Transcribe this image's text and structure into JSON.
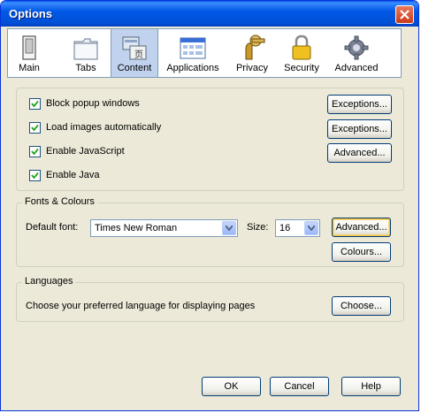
{
  "window": {
    "title": "Options"
  },
  "toolbar": {
    "items": [
      {
        "label": "Main",
        "icon": "main-icon"
      },
      {
        "label": "Tabs",
        "icon": "tabs-icon"
      },
      {
        "label": "Content",
        "icon": "content-icon",
        "selected": true
      },
      {
        "label": "Applications",
        "icon": "applications-icon"
      },
      {
        "label": "Privacy",
        "icon": "privacy-icon"
      },
      {
        "label": "Security",
        "icon": "security-icon"
      },
      {
        "label": "Advanced",
        "icon": "advanced-icon"
      }
    ]
  },
  "content": {
    "block_popups": {
      "label": "Block popup windows",
      "checked": true
    },
    "load_images": {
      "label": "Load images automatically",
      "checked": true
    },
    "enable_js": {
      "label": "Enable JavaScript",
      "checked": true
    },
    "enable_java": {
      "label": "Enable Java",
      "checked": true
    },
    "exceptions1": "Exceptions...",
    "exceptions2": "Exceptions...",
    "advanced_js": "Advanced..."
  },
  "fonts": {
    "legend": "Fonts & Colours",
    "default_font_label": "Default font:",
    "default_font_value": "Times New Roman",
    "size_label": "Size:",
    "size_value": "16",
    "advanced": "Advanced...",
    "colours": "Colours..."
  },
  "languages": {
    "legend": "Languages",
    "text": "Choose your preferred language for displaying pages",
    "choose": "Choose..."
  },
  "footer": {
    "ok": "OK",
    "cancel": "Cancel",
    "help": "Help"
  },
  "colors": {
    "titlebar": "#0054e3",
    "selected_tab": "#c1d2ee",
    "face": "#ece9d8"
  }
}
